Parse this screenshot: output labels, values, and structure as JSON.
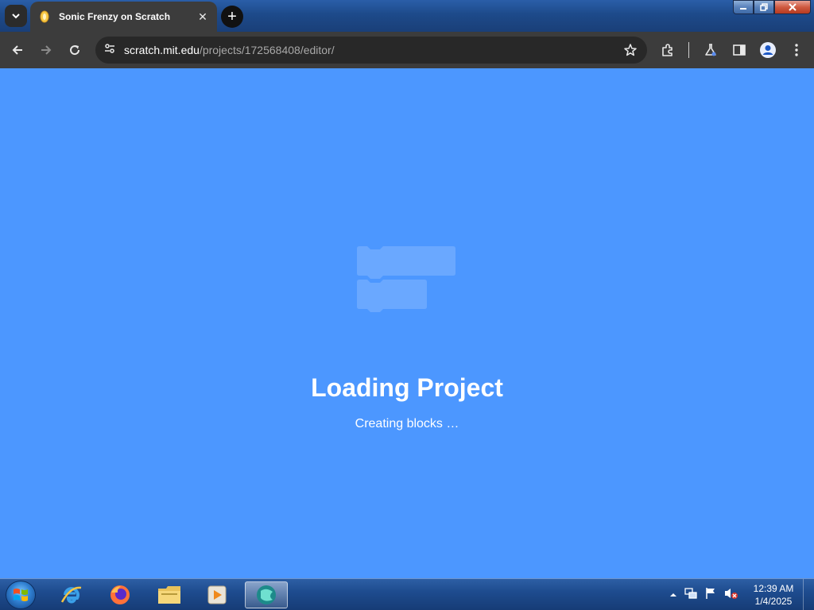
{
  "browser": {
    "tab": {
      "title": "Sonic Frenzy on Scratch",
      "favicon": "scratch-cat-icon"
    },
    "address": {
      "host": "scratch.mit.edu",
      "path": "/projects/172568408/editor/"
    },
    "icons": [
      "tab-search-icon",
      "close-icon",
      "new-tab-icon",
      "back-arrow-icon",
      "forward-arrow-icon",
      "reload-icon",
      "site-info-icon",
      "bookmark-star-icon",
      "extensions-icon",
      "labs-flask-icon",
      "side-panel-icon",
      "profile-icon",
      "menu-icon"
    ]
  },
  "page": {
    "title": "Loading Project",
    "message": "Creating blocks …",
    "background_color": "#4c97ff"
  },
  "taskbar": {
    "apps": [
      "internet-explorer-icon",
      "firefox-icon",
      "file-explorer-icon",
      "media-player-icon",
      "active-app-icon"
    ],
    "clock": {
      "time": "12:39 AM",
      "date": "1/4/2025"
    }
  }
}
